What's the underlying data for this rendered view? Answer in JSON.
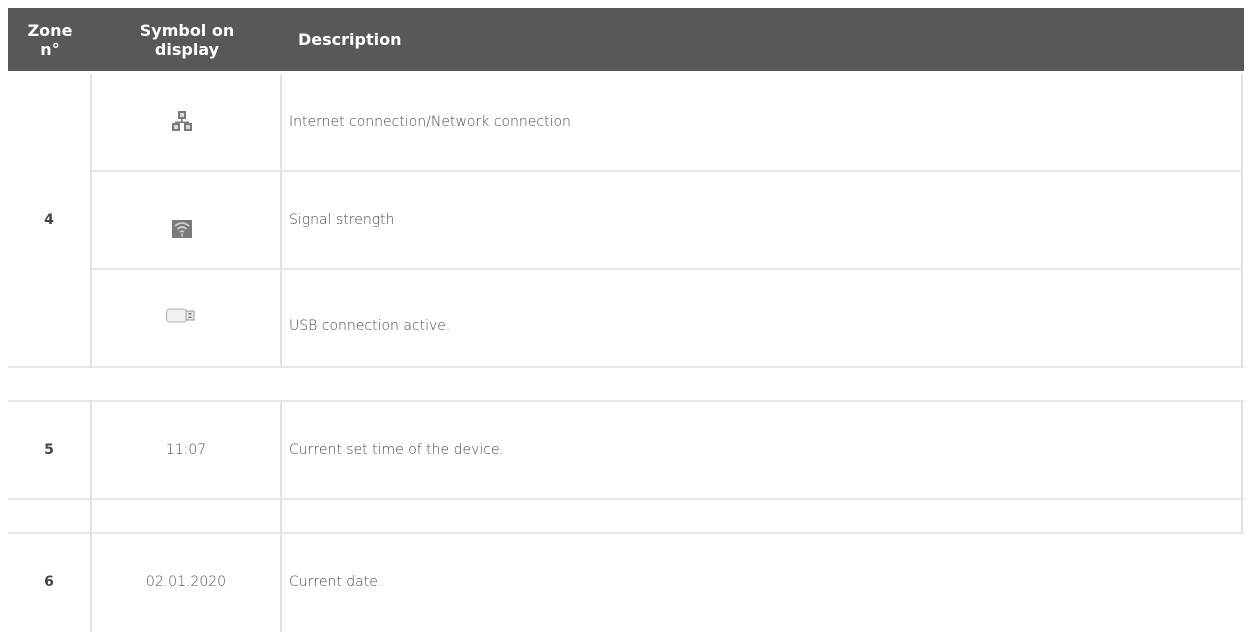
{
  "table": {
    "headers": {
      "zone_line1": "Zone",
      "zone_line2": "n°",
      "symbol_line1": "Symbol on",
      "symbol_line2": "display",
      "description": "Description"
    },
    "rows": [
      {
        "zone": "4",
        "entries": [
          {
            "symbol_icon": "network-connection-icon",
            "description": "Internet connection/Network connection"
          },
          {
            "symbol_icon": "signal-strength-icon",
            "description": "Signal strength"
          },
          {
            "symbol_icon": "usb-icon",
            "description": "USB connection active."
          }
        ]
      },
      {
        "zone": "5",
        "entries": [
          {
            "symbol_text": "11:07",
            "description": "Current set time of the device."
          }
        ]
      },
      {
        "zone": "6",
        "entries": [
          {
            "symbol_text": "02.01.2020",
            "description": "Current date."
          }
        ]
      }
    ]
  }
}
